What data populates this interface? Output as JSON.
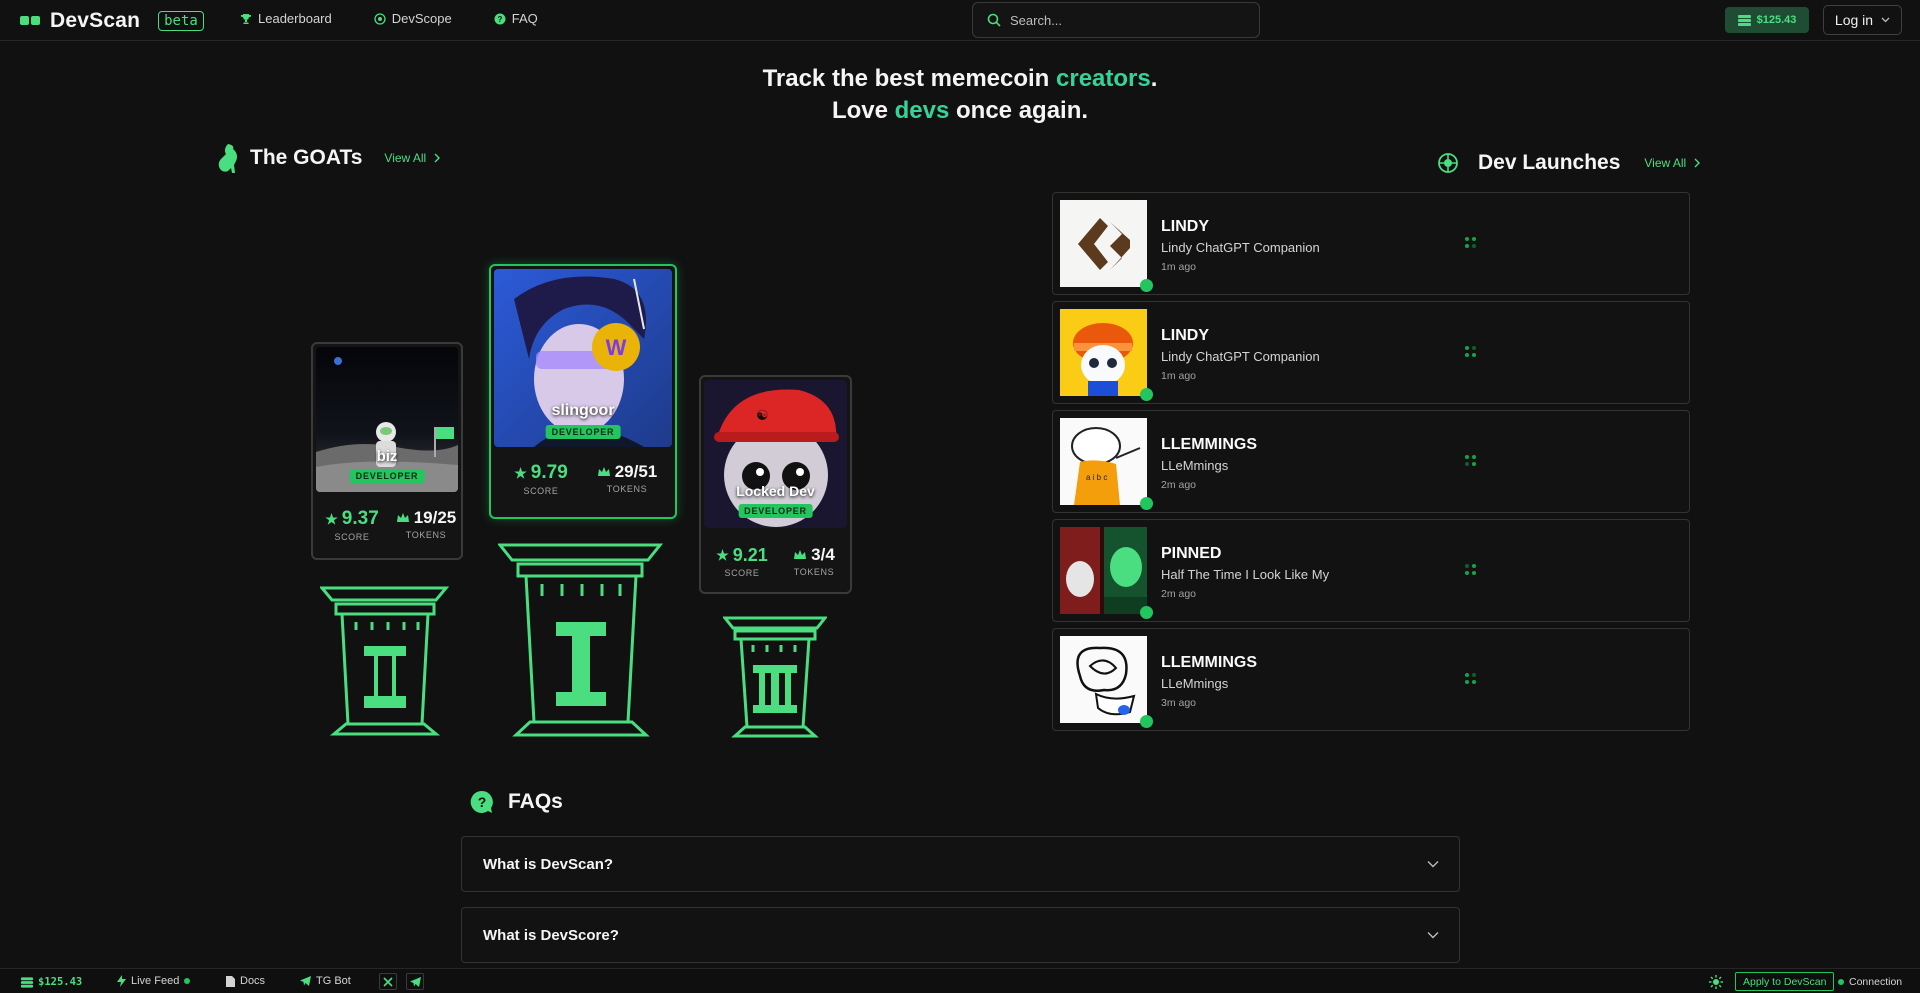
{
  "header": {
    "logo_text": "DevScan",
    "beta_label": "beta",
    "nav": [
      {
        "label": "Leaderboard",
        "icon": "trophy-icon"
      },
      {
        "label": "DevScope",
        "icon": "devscope-icon"
      },
      {
        "label": "FAQ",
        "icon": "help-icon"
      }
    ],
    "search_placeholder": "Search...",
    "balance": "$125.43",
    "login_label": "Log in"
  },
  "hero": {
    "line1_pre": "Track the best memecoin ",
    "line1_accent": "creators",
    "line1_post": ".",
    "line2_pre": "Love ",
    "line2_accent": "devs",
    "line2_post": " once again."
  },
  "goats": {
    "title": "The GOATs",
    "view_all": "View All",
    "badge_label": "DEVELOPER",
    "score_label": "SCORE",
    "tokens_label": "TOKENS",
    "devs": [
      {
        "rank": 2,
        "name": "biz",
        "score": "9.37",
        "tokens": "19/25"
      },
      {
        "rank": 1,
        "name": "slingoor",
        "score": "9.79",
        "tokens": "29/51"
      },
      {
        "rank": 3,
        "name": "Locked Dev",
        "score": "9.21",
        "tokens": "3/4"
      }
    ]
  },
  "launches": {
    "title": "Dev Launches",
    "view_all": "View All",
    "items": [
      {
        "symbol": "LINDY",
        "name": "Lindy ChatGPT Companion",
        "time": "1m ago"
      },
      {
        "symbol": "LINDY",
        "name": "Lindy ChatGPT Companion",
        "time": "1m ago"
      },
      {
        "symbol": "LLEMMINGS",
        "name": "LLeMmings",
        "time": "2m ago"
      },
      {
        "symbol": "PINNED",
        "name": "Half The Time I Look Like My",
        "time": "2m ago"
      },
      {
        "symbol": "LLEMMINGS",
        "name": "LLeMmings",
        "time": "3m ago"
      }
    ]
  },
  "faq": {
    "title": "FAQs",
    "items": [
      {
        "question": "What is DevScan?"
      },
      {
        "question": "What is DevScore?"
      }
    ]
  },
  "footer": {
    "balance": "$125.43",
    "live_feed": "Live Feed",
    "docs": "Docs",
    "tg_bot": "TG Bot",
    "apply": "Apply to DevScan",
    "connection": "Connection"
  },
  "colors": {
    "accent": "#4ade80",
    "accent_dark": "#22c55e",
    "teal": "#34d399",
    "background": "#111111"
  }
}
